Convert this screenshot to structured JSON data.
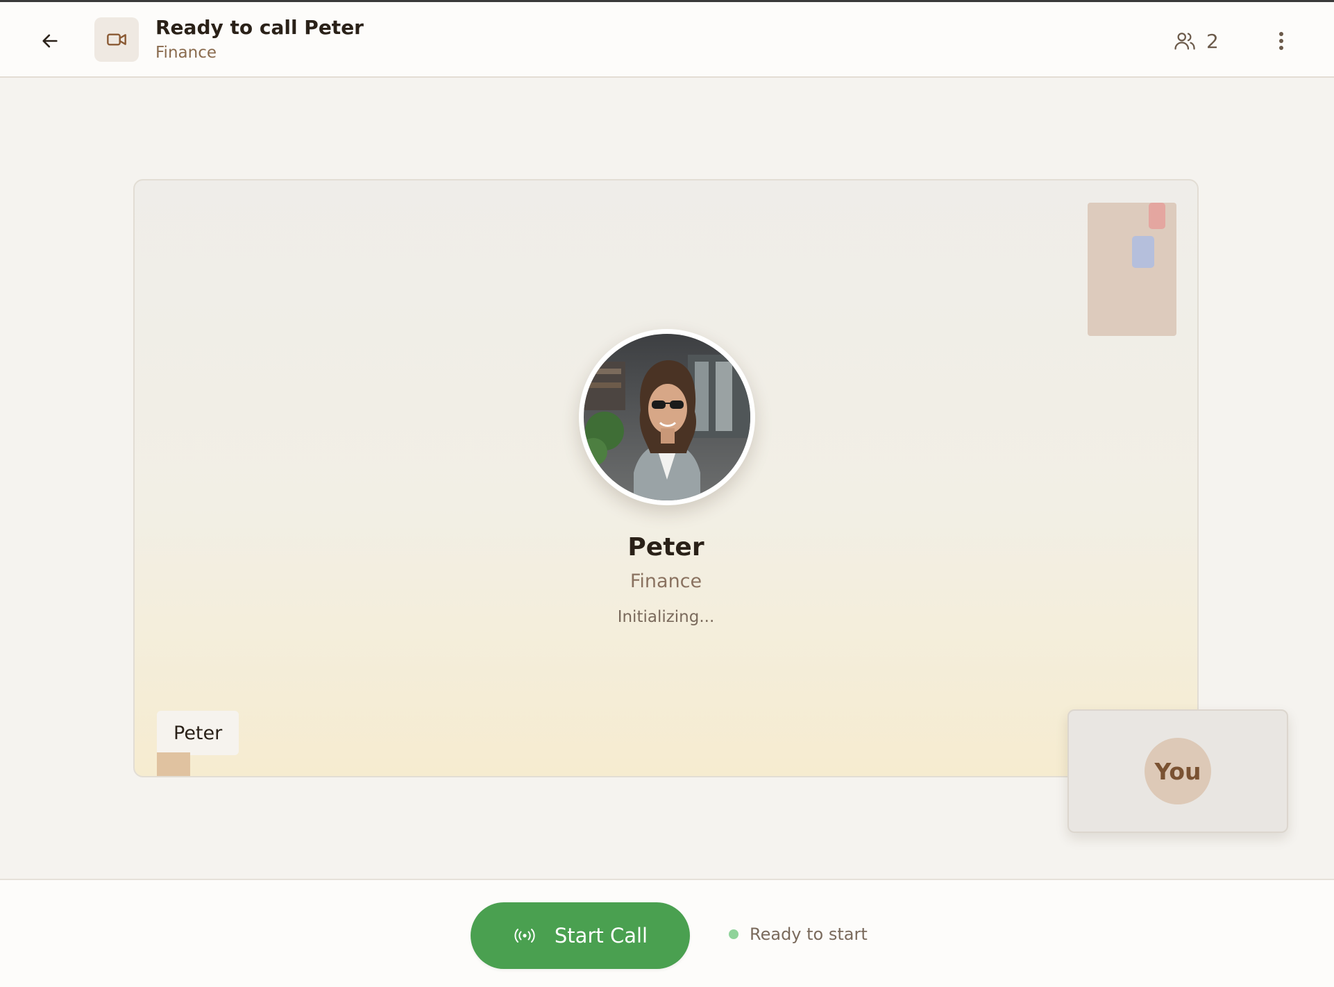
{
  "header": {
    "title": "Ready to call Peter",
    "subtitle": "Finance",
    "participants_count": "2",
    "icons": {
      "back": "arrow-left-icon",
      "video": "video-camera-icon",
      "participants": "users-icon",
      "more": "more-vertical-icon"
    }
  },
  "stage": {
    "contact_name": "Peter",
    "contact_department": "Finance",
    "status": "Initializing...",
    "name_tag": "Peter"
  },
  "self_view": {
    "label": "You"
  },
  "footer": {
    "start_button_label": "Start Call",
    "status_text": "Ready to start",
    "status_color": "#8fd39a",
    "button_color": "#4aa050",
    "icon": "broadcast-icon"
  }
}
